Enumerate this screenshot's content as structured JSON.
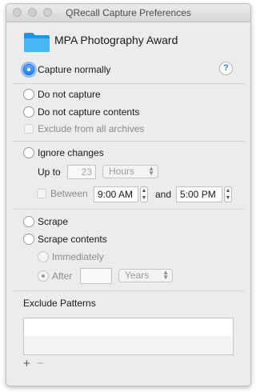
{
  "window": {
    "title": "QRecall Capture Preferences"
  },
  "header": {
    "item_name": "MPA Photography Award",
    "icon": "folder-icon",
    "accent": "#2aa4ec"
  },
  "options": {
    "capture_normally": "Capture normally",
    "help_symbol": "?",
    "do_not_capture": "Do not capture",
    "do_not_capture_contents": "Do not capture contents",
    "exclude_from_all_archives": "Exclude from all archives",
    "ignore_changes": "Ignore changes",
    "up_to_label": "Up to",
    "up_to_value": "23",
    "up_to_unit": "Hours",
    "between_label": "Between",
    "start_time": "9:00 AM",
    "and_label": "and",
    "end_time": "5:00 PM",
    "scrape": "Scrape",
    "scrape_contents": "Scrape contents",
    "immediately": "Immediately",
    "after_label": "After",
    "after_value": "",
    "after_unit": "Years"
  },
  "exclude": {
    "title": "Exclude Patterns",
    "add_symbol": "+",
    "remove_symbol": "−",
    "patterns": []
  },
  "colors": {
    "selected_radio": "#1c7df0",
    "window_bg": "#ececec"
  }
}
